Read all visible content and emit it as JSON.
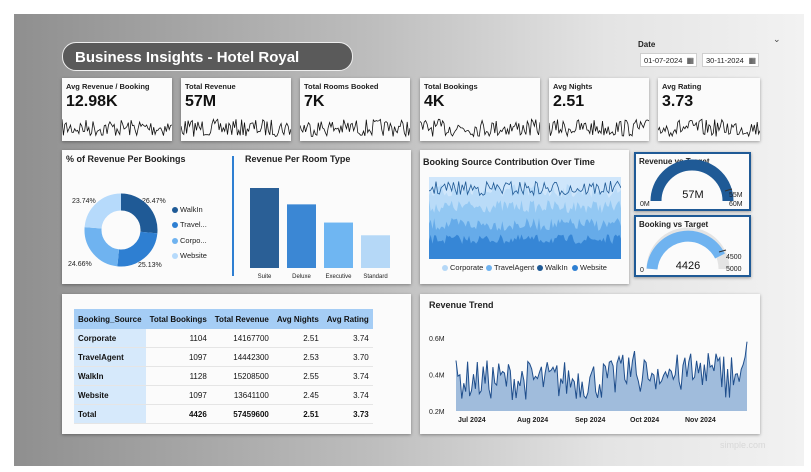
{
  "header": {
    "title": "Business Insights - Hotel Royal Retreat"
  },
  "date_filter": {
    "label": "Date",
    "start": "01-07-2024",
    "end": "30-11-2024",
    "calendar_icon": "calendar-icon",
    "expand_icon": "chevron-down-icon"
  },
  "kpis": [
    {
      "label": "Avg Revenue / Booking",
      "value": "12.98K"
    },
    {
      "label": "Total Revenue",
      "value": "57M"
    },
    {
      "label": "Total Rooms Booked",
      "value": "7K"
    },
    {
      "label": "Total Bookings",
      "value": "4K"
    },
    {
      "label": "Avg Nights",
      "value": "2.51"
    },
    {
      "label": "Avg Rating",
      "value": "3.73"
    }
  ],
  "donut": {
    "title": "% of Revenue Per Bookings",
    "labels": [
      "23.74%",
      "26.47%",
      "24.66%",
      "25.13%"
    ],
    "legend": [
      "WalkIn",
      "Travel...",
      "Corpo...",
      "Website"
    ]
  },
  "room_type": {
    "title": "Revenue Per Room Type"
  },
  "booking_source_area": {
    "title": "Booking Source Contribution Over Time",
    "legend": [
      "Corporate",
      "TravelAgent",
      "WalkIn",
      "Website"
    ]
  },
  "revenue_gauge": {
    "title": "Revenue vs Target",
    "value": "57M",
    "min": "0M",
    "target": "55M",
    "max": "60M"
  },
  "booking_gauge": {
    "title": "Booking vs Target",
    "value": "4426",
    "min": "0",
    "target": "4500",
    "max": "5000"
  },
  "table": {
    "headers": [
      "Booking_Source",
      "Total Bookings",
      "Total Revenue",
      "Avg Nights",
      "Avg Rating"
    ],
    "rows": [
      [
        "Corporate",
        "1104",
        "14167700",
        "2.51",
        "3.74"
      ],
      [
        "TravelAgent",
        "1097",
        "14442300",
        "2.53",
        "3.70"
      ],
      [
        "WalkIn",
        "1128",
        "15208500",
        "2.55",
        "3.74"
      ],
      [
        "Website",
        "1097",
        "13641100",
        "2.45",
        "3.74"
      ],
      [
        "Total",
        "4426",
        "57459600",
        "2.51",
        "3.73"
      ]
    ]
  },
  "revenue_trend": {
    "title": "Revenue Trend"
  },
  "watermark": "simple.com",
  "chart_data": [
    {
      "type": "pie",
      "title": "% of Revenue Per Bookings",
      "categories": [
        "WalkIn",
        "TravelAgent",
        "Corporate",
        "Website"
      ],
      "values": [
        26.47,
        25.13,
        24.66,
        23.74
      ],
      "colors": [
        "#1f5a96",
        "#2e7fd2",
        "#6fb3f0",
        "#b6dafb"
      ],
      "legend": "right"
    },
    {
      "type": "bar",
      "title": "Revenue Per Room Type",
      "categories": [
        "Suite",
        "Deluxe",
        "Executive",
        "Standard"
      ],
      "values": [
        22,
        17.5,
        12.5,
        9
      ],
      "colors": [
        "#2a5f96",
        "#3b87d4",
        "#6fb6f2",
        "#b5d8f7"
      ]
    },
    {
      "type": "line",
      "title": "Revenue Trend",
      "ylabel": "",
      "yticks": [
        "0.2M",
        "0.4M",
        "0.6M"
      ],
      "ylim": [
        0.2,
        0.6
      ],
      "xticks": [
        "Jul 2024",
        "Aug 2024",
        "Sep 2024",
        "Oct 2024",
        "Nov 2024"
      ],
      "color": "#1f4e8c"
    }
  ]
}
